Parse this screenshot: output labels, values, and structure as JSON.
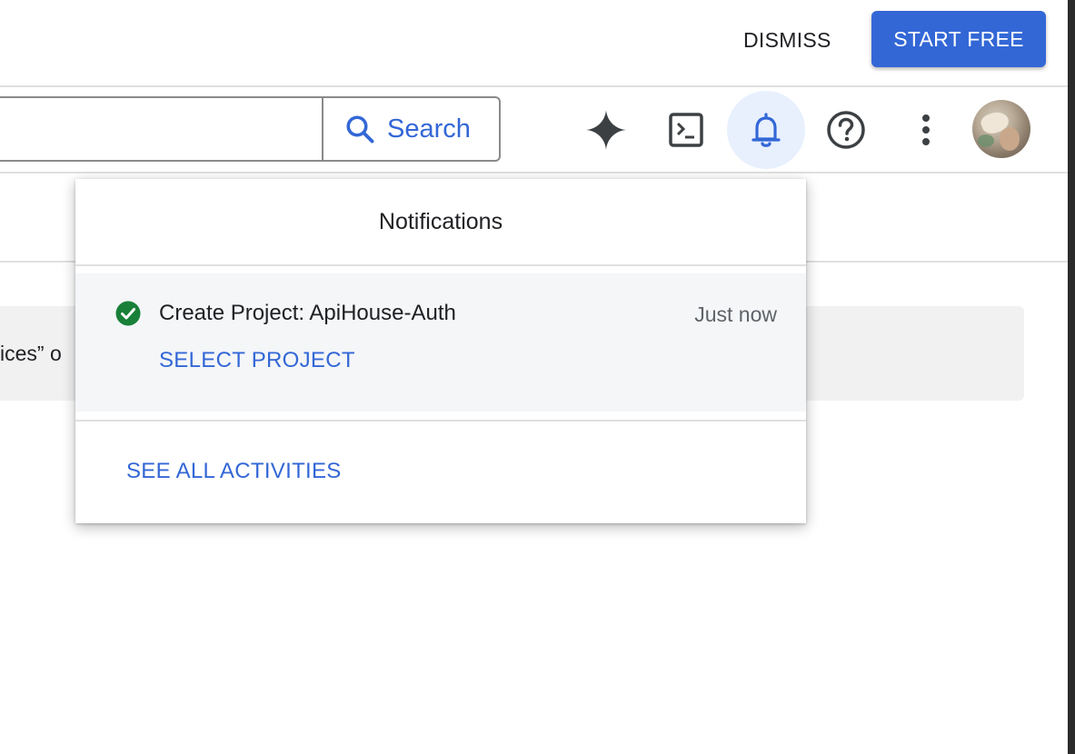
{
  "promo": {
    "dismiss_label": "DISMISS",
    "start_label": "START FREE"
  },
  "search": {
    "value": "",
    "button_label": "Search"
  },
  "toolbar_icons": [
    "gemini-sparkle-icon",
    "cloud-shell-icon",
    "bell-icon",
    "help-icon",
    "more-vert-icon",
    "avatar"
  ],
  "background": {
    "banner_text": "ices” o"
  },
  "notifications": {
    "title": "Notifications",
    "items": [
      {
        "title": "Create Project: ApiHouse-Auth",
        "time": "Just now",
        "status": "success",
        "action": "SELECT PROJECT"
      }
    ],
    "see_all": "SEE ALL ACTIVITIES"
  },
  "colors": {
    "accent": "#3367d6",
    "success": "#188038",
    "active_icon_bg": "#e8f0fe"
  }
}
